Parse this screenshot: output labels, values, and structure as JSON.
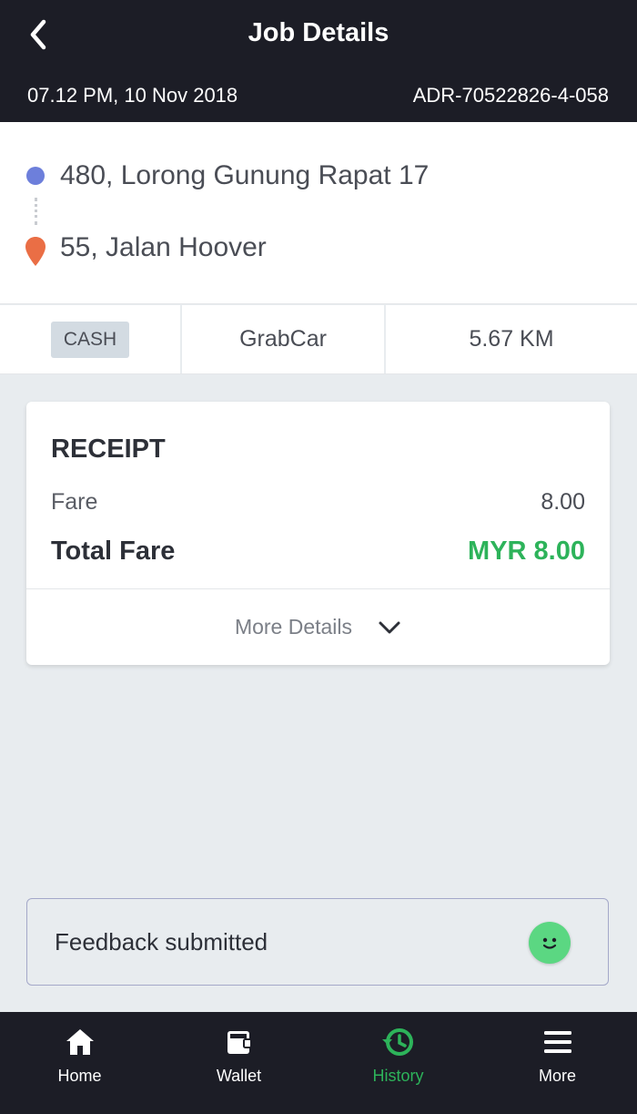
{
  "header": {
    "title": "Job Details",
    "datetime": "07.12 PM, 10 Nov 2018",
    "booking_id": "ADR-70522826-4-058"
  },
  "route": {
    "pickup": "480, Lorong Gunung Rapat 17",
    "dropoff": "55, Jalan Hoover"
  },
  "info": {
    "payment": "CASH",
    "service": "GrabCar",
    "distance": "5.67 KM"
  },
  "receipt": {
    "title": "RECEIPT",
    "fare_label": "Fare",
    "fare_value": "8.00",
    "total_label": "Total Fare",
    "total_value": "MYR 8.00",
    "more_details_label": "More Details"
  },
  "feedback": {
    "text": "Feedback submitted",
    "icon": "smiley-icon"
  },
  "tabs": [
    {
      "label": "Home",
      "icon": "home-icon"
    },
    {
      "label": "Wallet",
      "icon": "wallet-icon"
    },
    {
      "label": "History",
      "icon": "history-icon",
      "active": true
    },
    {
      "label": "More",
      "icon": "menu-icon"
    }
  ],
  "colors": {
    "header_bg": "#1c1d26",
    "accent_green": "#2db35a",
    "pickup_dot": "#6d7fdb",
    "dropoff_pin": "#ea6e45",
    "smiley_bg": "#5bd782"
  }
}
